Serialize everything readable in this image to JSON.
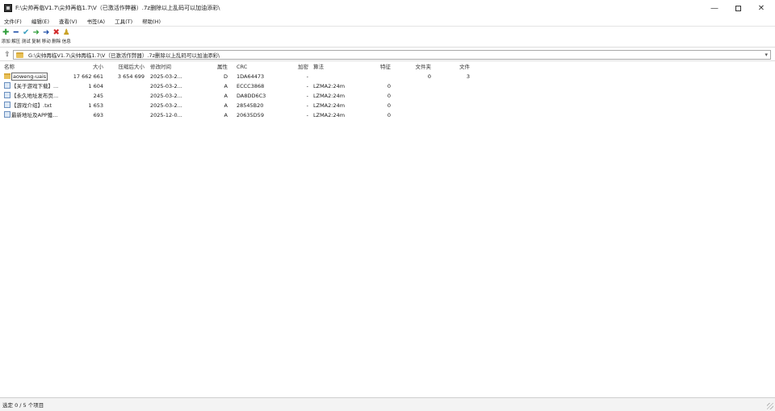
{
  "window": {
    "title": "F:\\尖帅再临V1.7\\尖帅再临1.7\\V（已激活作弊器）.7z删除以上乱码可以加油添彩\\",
    "minimize_glyph": "—",
    "close_glyph": "✕"
  },
  "menu": [
    {
      "label": "文件(F)",
      "name": "menu-file"
    },
    {
      "label": "编辑(E)",
      "name": "menu-edit"
    },
    {
      "label": "查看(V)",
      "name": "menu-view"
    },
    {
      "label": "书签(A)",
      "name": "menu-bookmarks"
    },
    {
      "label": "工具(T)",
      "name": "menu-tools"
    },
    {
      "label": "帮助(H)",
      "name": "menu-help"
    }
  ],
  "toolbar": [
    {
      "label": "添加",
      "icon": "add-icon",
      "glyph": "✚",
      "color": "#2f9e3a"
    },
    {
      "label": "解压",
      "icon": "extract-icon",
      "glyph": "━",
      "color": "#1f4fa8"
    },
    {
      "label": "测试",
      "icon": "test-icon",
      "glyph": "✔",
      "color": "#3aa0c0"
    },
    {
      "label": "复制",
      "icon": "copy-icon",
      "glyph": "➜",
      "color": "#2f9e3a"
    },
    {
      "label": "移动",
      "icon": "move-icon",
      "glyph": "➜",
      "color": "#1f4fa8"
    },
    {
      "label": "删除",
      "icon": "delete-icon",
      "glyph": "✖",
      "color": "#d22b2b"
    },
    {
      "label": "信息",
      "icon": "info-icon",
      "glyph": "♟",
      "color": "#c9a227"
    }
  ],
  "path": {
    "up_glyph": "⇧",
    "value": "G:\\尖帅再临V1.7\\尖帅再临1.7\\V（已激活作弊器）.7z删除以上乱码可以加油添彩\\",
    "dropdown_glyph": "▾"
  },
  "columns": {
    "name": "名称",
    "size": "大小",
    "packed": "压缩后大小",
    "modified": "修改时间",
    "attributes": "属性",
    "crc": "CRC",
    "encrypted": "加密",
    "method": "算法",
    "characteristics": "特征",
    "folders": "文件夹",
    "files": "文件"
  },
  "rows": [
    {
      "icon": "folder-icon",
      "name": "aoweng-uais",
      "size": "17 662 661",
      "packed": "3 654 699",
      "modified": "2025-03-2...",
      "attributes": "D",
      "crc": "1DA64473",
      "encrypted": "-",
      "method": "",
      "characteristics": "",
      "folders": "0",
      "files": "3"
    },
    {
      "icon": "file-icon",
      "name": "【关于游戏下载】...",
      "size": "1 604",
      "packed": "",
      "modified": "2025-03-2...",
      "attributes": "A",
      "crc": "ECCC3868",
      "encrypted": "-",
      "method": "LZMA2:24m",
      "characteristics": "0",
      "folders": "",
      "files": ""
    },
    {
      "icon": "file-icon",
      "name": "【永久地址发布页...",
      "size": "245",
      "packed": "",
      "modified": "2025-03-2...",
      "attributes": "A",
      "crc": "DA8DD6C3",
      "encrypted": "-",
      "method": "LZMA2:24m",
      "characteristics": "0",
      "folders": "",
      "files": ""
    },
    {
      "icon": "file-icon",
      "name": "【游戏介绍】.txt",
      "size": "1 653",
      "packed": "",
      "modified": "2025-03-2...",
      "attributes": "A",
      "crc": "28545B20",
      "encrypted": "-",
      "method": "LZMA2:24m",
      "characteristics": "0",
      "folders": "",
      "files": ""
    },
    {
      "icon": "file-icon",
      "name": "最新地址及APP獲...",
      "size": "693",
      "packed": "",
      "modified": "2025-12-0...",
      "attributes": "A",
      "crc": "20635D59",
      "encrypted": "-",
      "method": "LZMA2:24m",
      "characteristics": "0",
      "folders": "",
      "files": ""
    }
  ],
  "status": {
    "text": "选定 0 / 5 个项目"
  }
}
